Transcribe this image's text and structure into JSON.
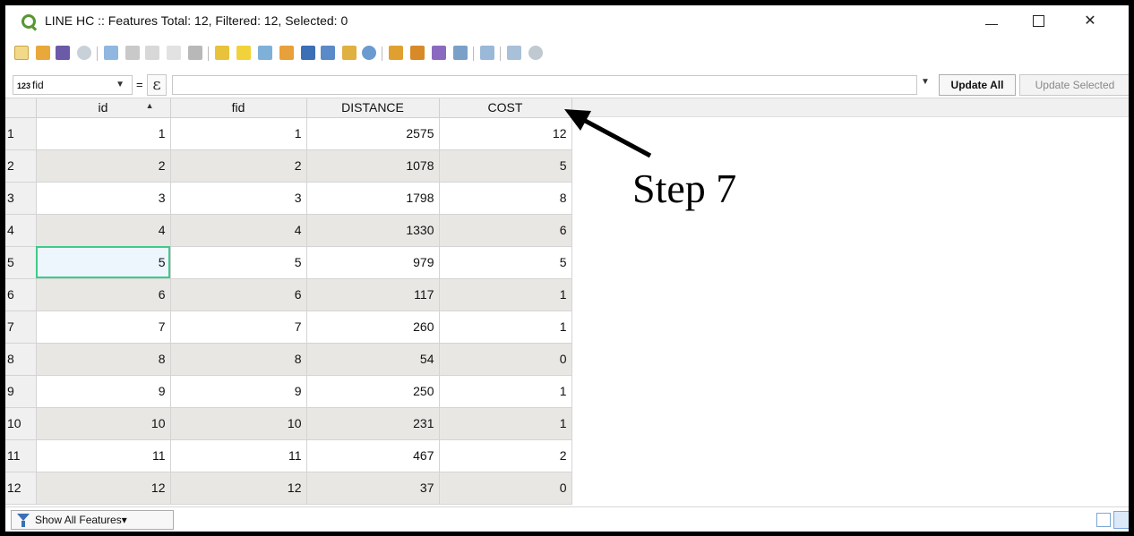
{
  "window": {
    "title": "LINE HC :: Features Total: 12, Filtered: 12, Selected: 0",
    "minimize_glyph": "—",
    "close_glyph": "✕"
  },
  "expression_bar": {
    "field_type": "123",
    "field_name": "fid",
    "equals": "=",
    "expression_glyph": "ε",
    "update_all": "Update All",
    "update_selected": "Update Selected"
  },
  "table": {
    "columns": [
      "id",
      "fid",
      "DISTANCE",
      "COST"
    ],
    "sorted_column": "id",
    "selected_cell": {
      "row": 5,
      "column": "id"
    },
    "rows": [
      {
        "n": "1",
        "id": "1",
        "fid": "1",
        "distance": "2575",
        "cost": "12"
      },
      {
        "n": "2",
        "id": "2",
        "fid": "2",
        "distance": "1078",
        "cost": "5"
      },
      {
        "n": "3",
        "id": "3",
        "fid": "3",
        "distance": "1798",
        "cost": "8"
      },
      {
        "n": "4",
        "id": "4",
        "fid": "4",
        "distance": "1330",
        "cost": "6"
      },
      {
        "n": "5",
        "id": "5",
        "fid": "5",
        "distance": "979",
        "cost": "5"
      },
      {
        "n": "6",
        "id": "6",
        "fid": "6",
        "distance": "117",
        "cost": "1"
      },
      {
        "n": "7",
        "id": "7",
        "fid": "7",
        "distance": "260",
        "cost": "1"
      },
      {
        "n": "8",
        "id": "8",
        "fid": "8",
        "distance": "54",
        "cost": "0"
      },
      {
        "n": "9",
        "id": "9",
        "fid": "9",
        "distance": "250",
        "cost": "1"
      },
      {
        "n": "10",
        "id": "10",
        "fid": "10",
        "distance": "231",
        "cost": "1"
      },
      {
        "n": "11",
        "id": "11",
        "fid": "11",
        "distance": "467",
        "cost": "2"
      },
      {
        "n": "12",
        "id": "12",
        "fid": "12",
        "distance": "37",
        "cost": "0"
      }
    ]
  },
  "status": {
    "show_all_features": "Show All Features"
  },
  "annotation": {
    "step_label": "Step 7"
  },
  "colors": {
    "qgis_green": "#589632",
    "selection_outline": "#3ecb8a",
    "alt_row": "#e9e7e4"
  },
  "icons": {
    "app": "qgis-logo-icon",
    "filter": "filter-funnel-icon",
    "form_view": "form-view-icon",
    "table_view": "table-view-icon"
  }
}
